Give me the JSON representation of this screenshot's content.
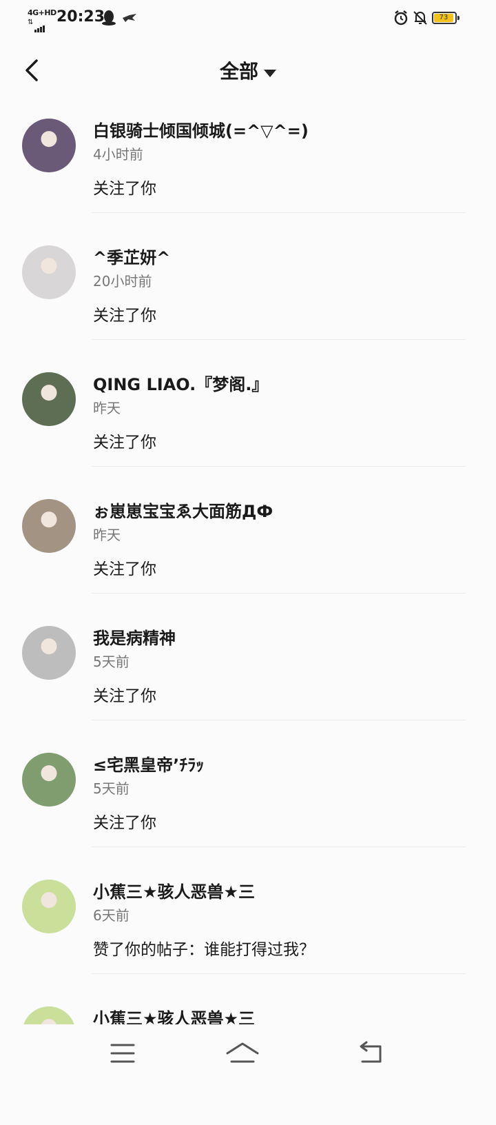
{
  "status_bar": {
    "network_type": "4G+HD",
    "time": "20:23",
    "battery_level": "73",
    "icons": [
      "qq-icon",
      "bird-icon",
      "alarm-icon",
      "mute-bell-icon",
      "battery-icon"
    ]
  },
  "header": {
    "title": "全部"
  },
  "notifications": [
    {
      "name": "白银骑士倾国倾城(=^▽^=)",
      "time": "4小时前",
      "action": "关注了你",
      "avatar_color": "#6a5a78"
    },
    {
      "name": "^季芷妍^",
      "time": "20小时前",
      "action": "关注了你",
      "avatar_color": "#d9d6d8"
    },
    {
      "name": "QING  LIAO.『梦阁.』",
      "time": "昨天",
      "action": "关注了你",
      "avatar_color": "#5d6e55"
    },
    {
      "name": "ぉ崽崽宝宝ゑ大面筋ДФ",
      "time": "昨天",
      "action": "关注了你",
      "avatar_color": "#a39383"
    },
    {
      "name": "我是病精神",
      "time": "5天前",
      "action": "关注了你",
      "avatar_color": "#bdbdbd"
    },
    {
      "name": "≤宅黑皇帝’ﾁﾗｯ",
      "time": "5天前",
      "action": "关注了你",
      "avatar_color": "#7f9d6e"
    },
    {
      "name": "小蕉三★骇人恶兽★三",
      "time": "6天前",
      "action": "赞了你的帖子：谁能打得过我？",
      "avatar_color": "#c9df9a"
    },
    {
      "name": "小蕉三★骇人恶兽★三",
      "time": "",
      "action": "",
      "avatar_color": "#c9df9a"
    }
  ],
  "nav_bar": {
    "icons": [
      "menu-icon",
      "home-icon",
      "back-icon"
    ]
  }
}
